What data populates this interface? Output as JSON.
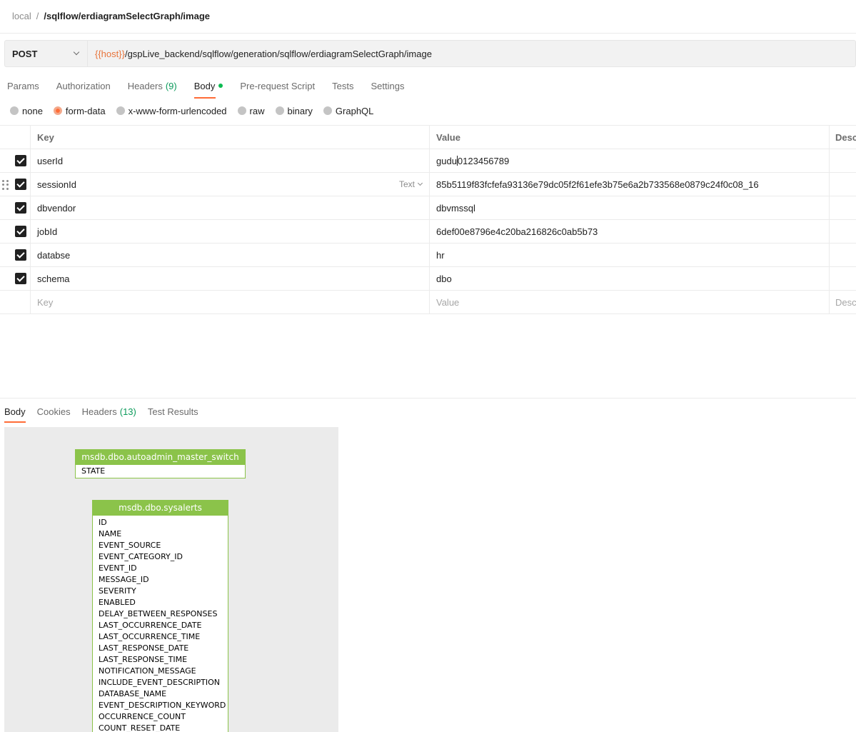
{
  "breadcrumb": {
    "root": "local",
    "separator": "/",
    "current": "/sqlflow/erdiagramSelectGraph/image"
  },
  "request": {
    "method": "POST",
    "url_variable": "{{host}}",
    "url_path": "/gspLive_backend/sqlflow/generation/sqlflow/erdiagramSelectGraph/image"
  },
  "request_tabs": {
    "params": "Params",
    "authorization": "Authorization",
    "headers": "Headers",
    "headers_count": "(9)",
    "body": "Body",
    "pre_request": "Pre-request Script",
    "tests": "Tests",
    "settings": "Settings"
  },
  "body_types": {
    "none": "none",
    "form_data": "form-data",
    "urlencoded": "x-www-form-urlencoded",
    "raw": "raw",
    "binary": "binary",
    "graphql": "GraphQL"
  },
  "table": {
    "headers": {
      "key": "Key",
      "value": "Value",
      "description": "Desc"
    },
    "rows": [
      {
        "key": "userId",
        "value_before_cursor": "gudu",
        "value_after_cursor": "0123456789"
      },
      {
        "key": "sessionId",
        "type": "Text",
        "value": "85b5119f83fcfefa93136e79dc05f2f61efe3b75e6a2b733568e0879c24f0c08_16"
      },
      {
        "key": "dbvendor",
        "value": "dbvmssql"
      },
      {
        "key": "jobId",
        "value": "6def00e8796e4c20ba216826c0ab5b73"
      },
      {
        "key": "databse",
        "value": "hr"
      },
      {
        "key": "schema",
        "value": "dbo"
      }
    ],
    "placeholders": {
      "key": "Key",
      "value": "Value",
      "description": "Desc"
    }
  },
  "response_tabs": {
    "body": "Body",
    "cookies": "Cookies",
    "headers": "Headers",
    "headers_count": "(13)",
    "test_results": "Test Results"
  },
  "erd": {
    "table1": {
      "name": "msdb.dbo.autoadmin_master_switch",
      "columns": [
        "STATE"
      ]
    },
    "table2": {
      "name": "msdb.dbo.sysalerts",
      "columns": [
        "ID",
        "NAME",
        "EVENT_SOURCE",
        "EVENT_CATEGORY_ID",
        "EVENT_ID",
        "MESSAGE_ID",
        "SEVERITY",
        "ENABLED",
        "DELAY_BETWEEN_RESPONSES",
        "LAST_OCCURRENCE_DATE",
        "LAST_OCCURRENCE_TIME",
        "LAST_RESPONSE_DATE",
        "LAST_RESPONSE_TIME",
        "NOTIFICATION_MESSAGE",
        "INCLUDE_EVENT_DESCRIPTION",
        "DATABASE_NAME",
        "EVENT_DESCRIPTION_KEYWORD",
        "OCCURRENCE_COUNT",
        "COUNT_RESET_DATE"
      ]
    }
  },
  "colors": {
    "accent": "#ff6c37",
    "url_variable": "#e8743b",
    "count_green": "#0d9b5c",
    "erd_green": "#8bc34a"
  }
}
